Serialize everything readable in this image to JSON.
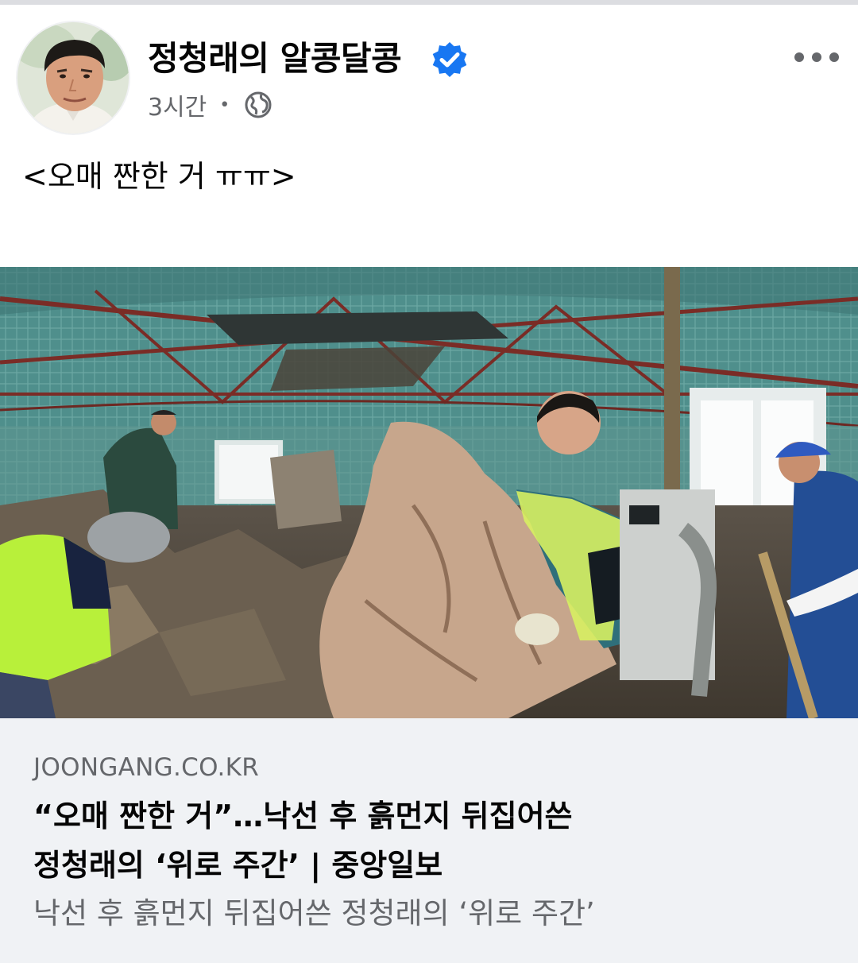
{
  "post": {
    "author": "정청래의 알콩달콩",
    "verified": true,
    "time": "3시간",
    "separator": "•",
    "privacy_icon": "globe-icon",
    "menu_icon": "more-horizontal-icon",
    "text": "<오매 짠한 거 ㅠㅠ>"
  },
  "photo": {
    "icon": "news-photo"
  },
  "link": {
    "domain": "JOONGANG.CO.KR",
    "title_line1": "“오매 짠한 거”…낙선 후 흙먼지 뒤집어쓴",
    "title_line2": "정청래의 ‘위로 주간’ | 중앙일보",
    "description": "낙선 후 흙먼지 뒤집어쓴 정청래의 ‘위로 주간’"
  },
  "colors": {
    "accent": "#1877f2",
    "text_primary": "#050505",
    "text_secondary": "#65676b",
    "card_background": "#f0f2f5"
  }
}
